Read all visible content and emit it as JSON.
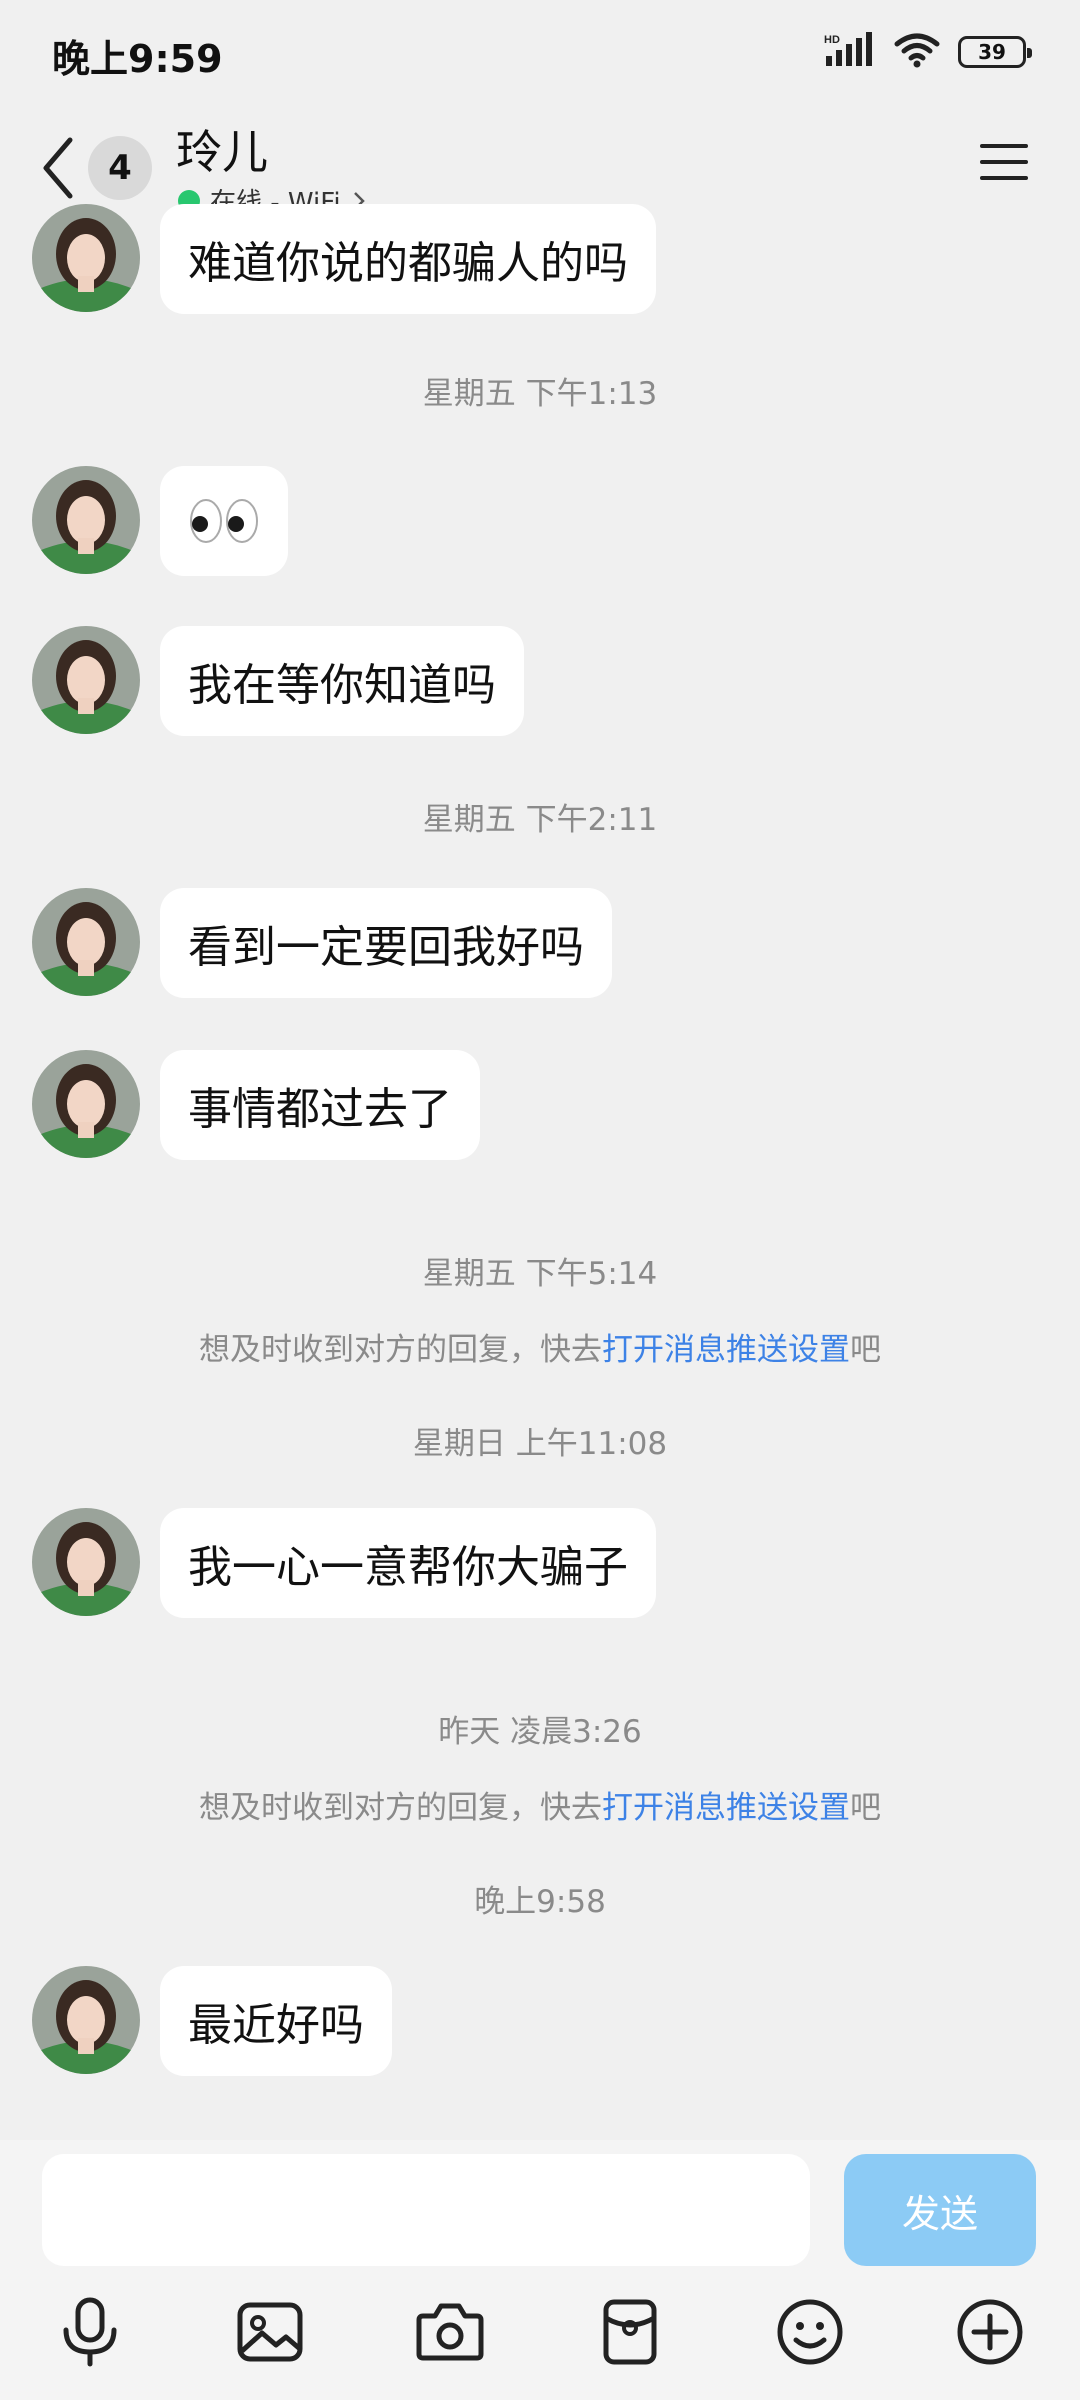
{
  "status_bar": {
    "time": "晚上9:59",
    "network_label": "HD",
    "battery": "39"
  },
  "header": {
    "unread_count": "4",
    "title": "玲儿",
    "status": "在线 - WiFi"
  },
  "messages": [
    {
      "text": "难道你说的都骗人的吗"
    },
    {
      "text": "👀"
    },
    {
      "text": "我在等你知道吗"
    },
    {
      "text": "看到一定要回我好吗"
    },
    {
      "text": "事情都过去了"
    },
    {
      "text": "我一心一意帮你大骗子"
    },
    {
      "text": "最近好吗"
    }
  ],
  "timestamps": [
    "星期五 下午1:13",
    "星期五 下午2:11",
    "星期五 下午5:14",
    "星期日 上午11:08",
    "昨天 凌晨3:26",
    "晚上9:58"
  ],
  "notice": {
    "prefix": "想及时收到对方的回复，快去",
    "link": "打开消息推送设置",
    "suffix": "吧"
  },
  "input": {
    "value": "",
    "placeholder": ""
  },
  "send_label": "发送",
  "tools": [
    "microphone-icon",
    "image-icon",
    "camera-icon",
    "red-packet-icon",
    "emoji-icon",
    "plus-icon"
  ]
}
